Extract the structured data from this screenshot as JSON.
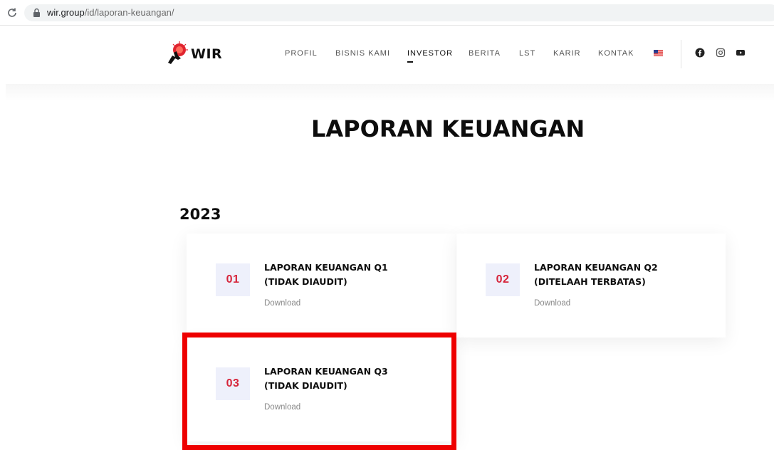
{
  "browser": {
    "url_host": "wir.group",
    "url_path": "/id/laporan-keuangan/"
  },
  "header": {
    "logo_text": "WIR",
    "nav": [
      {
        "label": "PROFIL"
      },
      {
        "label": "BISNIS KAMI"
      },
      {
        "label": "INVESTOR"
      },
      {
        "label": "BERITA"
      },
      {
        "label": "LST"
      },
      {
        "label": "KARIR"
      },
      {
        "label": "KONTAK"
      }
    ],
    "active_nav": "INVESTOR",
    "social": [
      "facebook-icon",
      "instagram-icon",
      "youtube-icon"
    ]
  },
  "page": {
    "title": "LAPORAN KEUANGAN",
    "year": "2023",
    "reports": [
      {
        "number": "01",
        "title_line1": "LAPORAN KEUANGAN Q1",
        "title_line2": "(TIDAK DIAUDIT)",
        "link": "Download"
      },
      {
        "number": "02",
        "title_line1": "LAPORAN KEUANGAN Q2",
        "title_line2": "(DITELAAH TERBATAS)",
        "link": "Download"
      },
      {
        "number": "03",
        "title_line1": "LAPORAN KEUANGAN Q3",
        "title_line2": "(TIDAK DIAUDIT)",
        "link": "Download"
      }
    ]
  },
  "colors": {
    "accent_number": "#d6243a",
    "number_bg": "#eef0fb",
    "highlight": "#ee0000"
  }
}
